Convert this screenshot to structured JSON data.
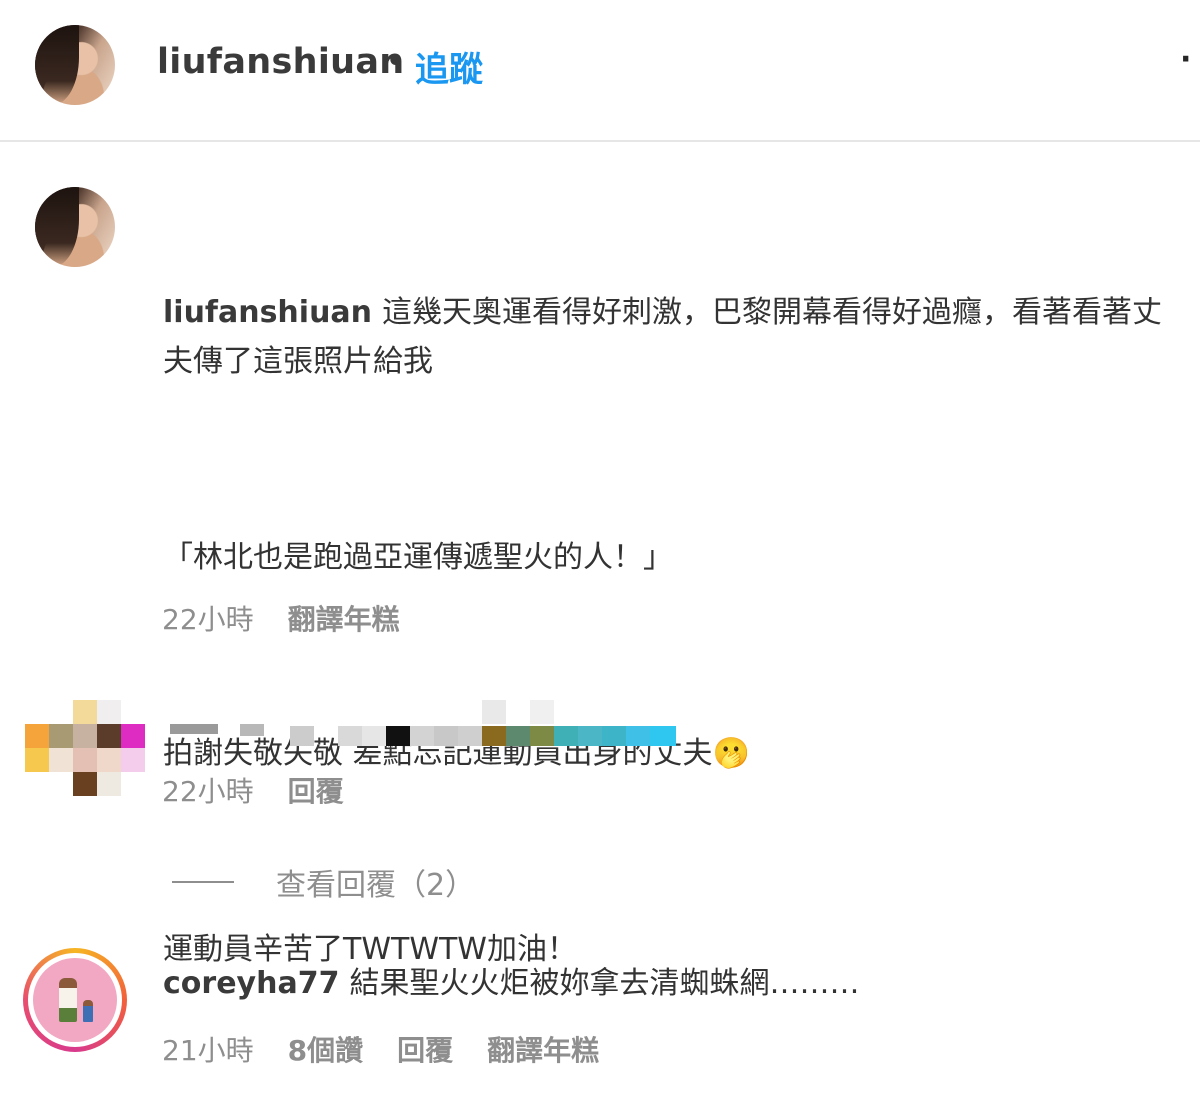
{
  "header": {
    "username": "liufanshiuan",
    "separator": "•",
    "follow_label": "追蹤",
    "more_label": "·"
  },
  "caption": {
    "username": "liufanshiuan",
    "paragraphs": [
      "這幾天奧運看得好刺激，巴黎開幕看得好過癮，看著看著丈夫傳了這張照片給我",
      "「林北也是跑過亞運傳遞聖火的人！」",
      "拍謝失敬失敬 差點忘記運動員出身的丈夫🫢",
      "運動員辛苦了TWTWTW加油！"
    ],
    "time": "22小時",
    "translate_label": "翻譯年糕"
  },
  "comment_1": {
    "time": "22小時",
    "reply_label": "回覆",
    "view_replies_label": "查看回覆（2）"
  },
  "comment_2": {
    "username": "coreyha77",
    "text": "結果聖火火炬被妳拿去清蜘蛛網………",
    "time": "21小時",
    "likes": "8個讚",
    "reply_label": "回覆",
    "translate_label": "翻譯年糕"
  },
  "colors": {
    "follow": "#1a97f0",
    "muted": "#8e8e8e",
    "divider": "#e6e6e6"
  }
}
